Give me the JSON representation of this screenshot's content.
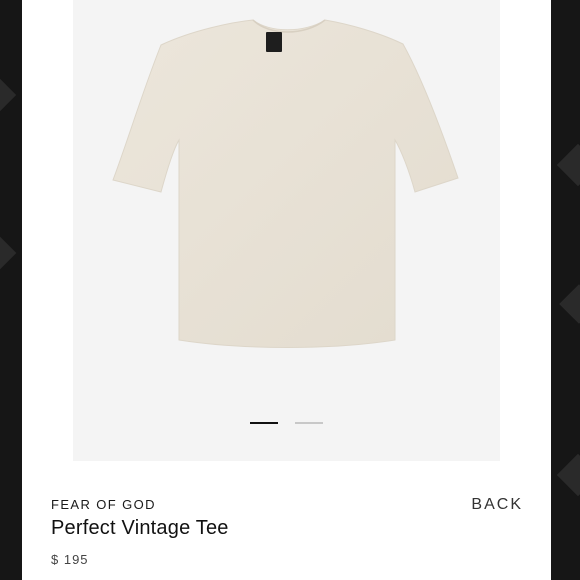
{
  "product": {
    "brand": "FEAR OF GOD",
    "name": "Perfect Vintage Tee",
    "price": "$ 195"
  },
  "navigation": {
    "back_label": "BACK"
  },
  "carousel": {
    "total_slides": 2,
    "active_slide": 1
  },
  "colors": {
    "shirt": "#e9e3d7",
    "image_background": "#f4f4f4",
    "page_background": "#111111"
  }
}
